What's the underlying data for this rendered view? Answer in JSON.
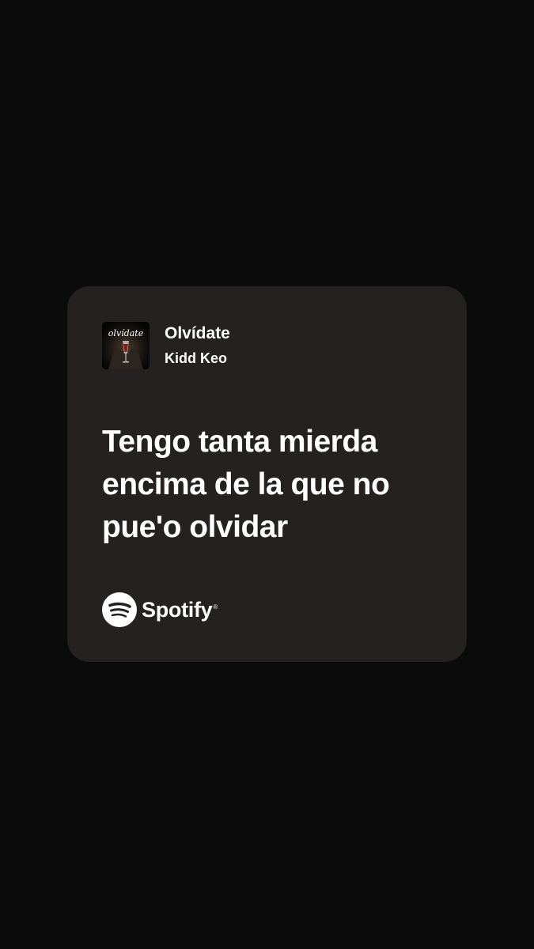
{
  "track": {
    "title": "Olvídate",
    "artist": "Kidd Keo",
    "cover_text": "olvídate"
  },
  "lyrics": {
    "lines": [
      "Tengo tanta mierda",
      "encima de la que no",
      "pue'o olvidar"
    ]
  },
  "brand": {
    "name": "Spotify",
    "icon": "spotify-logo-icon",
    "registered_mark": "®"
  },
  "colors": {
    "background": "#0c0b0b",
    "card": "#242120",
    "text": "#ffffff"
  }
}
